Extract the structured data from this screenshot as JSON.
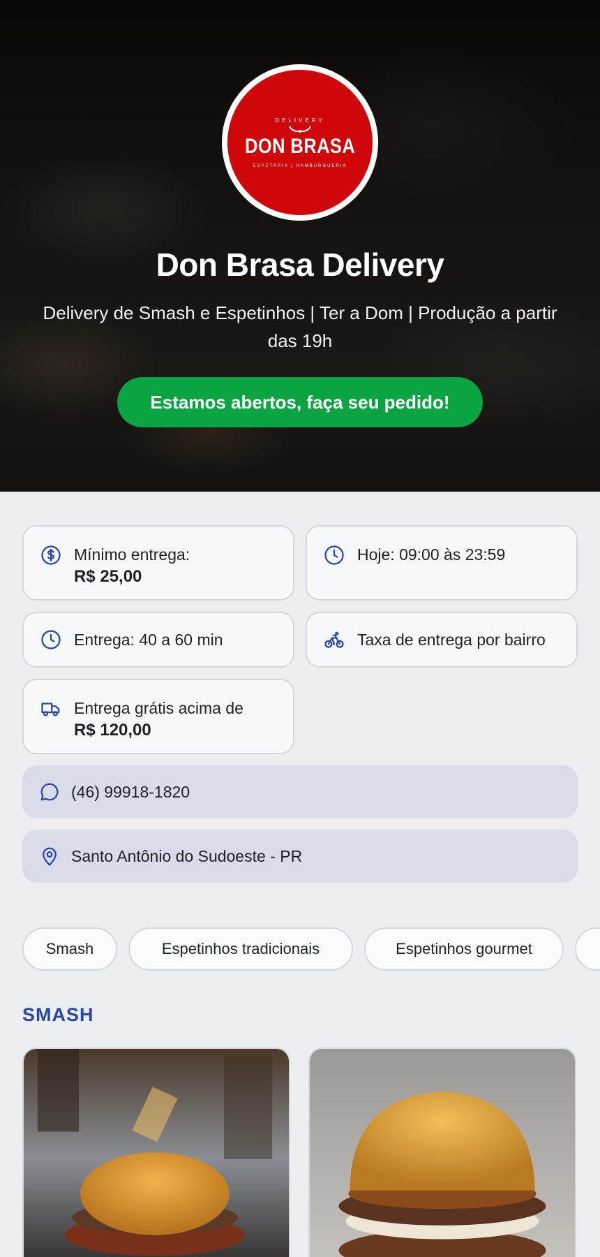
{
  "store": {
    "logo": {
      "top_text": "DELIVERY",
      "name": "DON BRASA",
      "sub_text": "ESPETARIA | HAMBURGUERIA",
      "color": "#d0070a"
    },
    "title": "Don Brasa Delivery",
    "description": "Delivery de Smash e Espetinhos | Ter a Dom | Produção a partir das 19h",
    "status_button": "Estamos abertos, faça seu pedido!",
    "status_color": "#0aa442"
  },
  "info": {
    "min_order_label": "Mínimo entrega:",
    "min_order_value": "R$ 25,00",
    "hours": "Hoje: 09:00 às 23:59",
    "delivery_time": "Entrega: 40 a 60 min",
    "delivery_fee": "Taxa de entrega por bairro",
    "free_delivery_label": "Entrega grátis acima de",
    "free_delivery_value": "R$ 120,00",
    "phone": "(46) 99918-1820",
    "location": "Santo Antônio do Sudoeste - PR"
  },
  "categories": [
    "Smash",
    "Espetinhos tradicionais",
    "Espetinhos gourmet"
  ],
  "section": {
    "title": "SMASH"
  },
  "icons": {
    "min_order": "dollar-circle-icon",
    "hours": "clock-icon",
    "delivery_time": "clock-icon",
    "delivery_fee": "bicycle-icon",
    "free_delivery": "truck-icon",
    "phone": "chat-bubble-icon",
    "location": "map-pin-icon"
  },
  "colors": {
    "accent": "#2748a8",
    "icon": "#2748a8",
    "background": "#eceef2"
  }
}
